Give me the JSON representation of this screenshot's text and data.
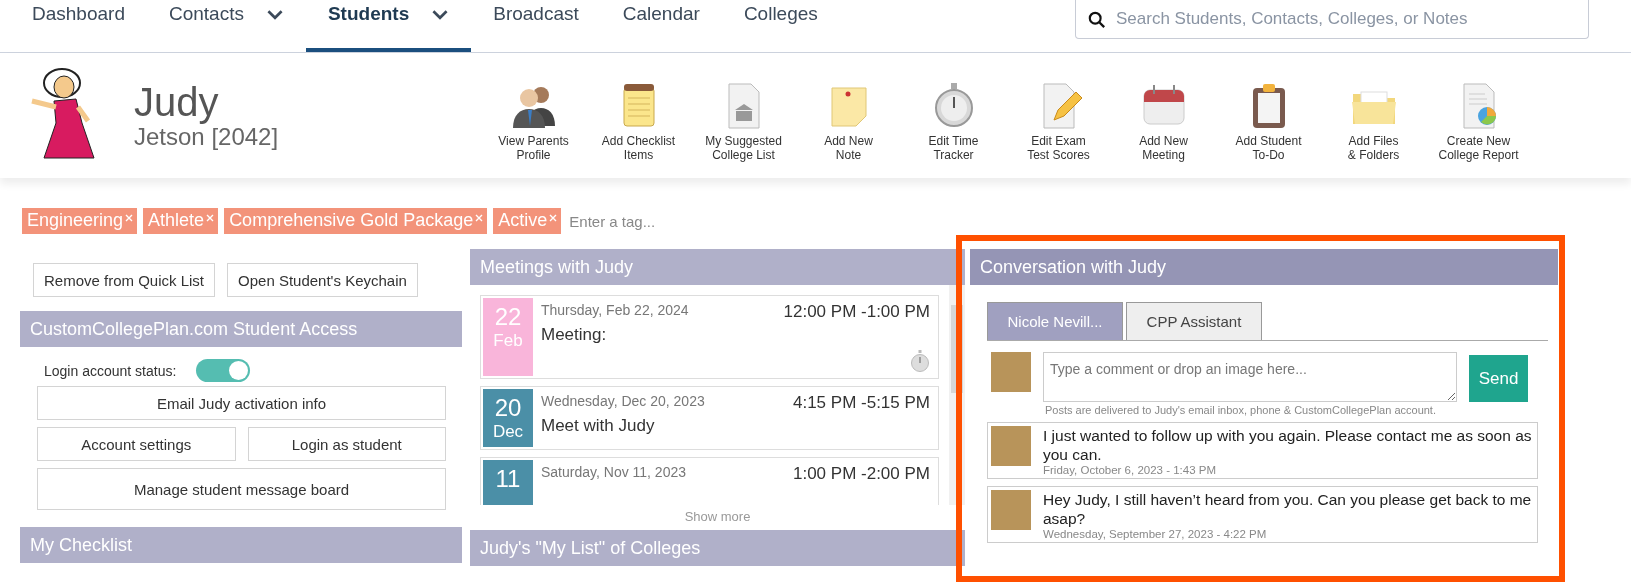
{
  "nav": {
    "items": [
      {
        "label": "Dashboard",
        "selected": false,
        "dropdown": false
      },
      {
        "label": "Contacts",
        "selected": false,
        "dropdown": true
      },
      {
        "label": "Students",
        "selected": true,
        "dropdown": true
      },
      {
        "label": "Broadcast",
        "selected": false,
        "dropdown": false
      },
      {
        "label": "Calendar",
        "selected": false,
        "dropdown": false
      },
      {
        "label": "Colleges",
        "selected": false,
        "dropdown": false
      }
    ],
    "search": {
      "placeholder": "Search Students, Contacts, Colleges, or Notes"
    }
  },
  "student": {
    "first_name": "Judy",
    "last_name": "Jetson [2042]"
  },
  "toolbar": [
    {
      "kind": "people",
      "lines": [
        "View Parents",
        "Profile"
      ]
    },
    {
      "kind": "notepad",
      "lines": [
        "Add Checklist",
        "Items"
      ]
    },
    {
      "kind": "college-doc",
      "lines": [
        "My Suggested",
        "College List"
      ]
    },
    {
      "kind": "note",
      "lines": [
        "Add New",
        "Note"
      ]
    },
    {
      "kind": "stopwatch",
      "lines": [
        "Edit Time",
        "Tracker"
      ]
    },
    {
      "kind": "doc-pencil",
      "lines": [
        "Edit Exam",
        "Test Scores"
      ]
    },
    {
      "kind": "calendar",
      "lines": [
        "Add New",
        "Meeting"
      ]
    },
    {
      "kind": "clipboard",
      "lines": [
        "Add Student",
        "To-Do"
      ]
    },
    {
      "kind": "folder",
      "lines": [
        "Add Files",
        "& Folders"
      ]
    },
    {
      "kind": "report",
      "lines": [
        "Create New",
        "College Report"
      ]
    }
  ],
  "tags": {
    "items": [
      "Engineering",
      "Athlete",
      "Comprehensive Gold Package",
      "Active"
    ],
    "placeholder": "Enter a tag..."
  },
  "left": {
    "buttons": [
      "Remove from Quick List",
      "Open Student's Keychain"
    ],
    "access": {
      "title": "CustomCollegePlan.com Student Access",
      "status_label": "Login account status:",
      "status_on": true,
      "actions": [
        [
          "Email Judy activation info"
        ],
        [
          "Account settings",
          "Login as student"
        ],
        [
          "Manage student message board"
        ]
      ]
    },
    "checklist": {
      "title": "My Checklist"
    }
  },
  "meetings": {
    "title": "Meetings with Judy",
    "items": [
      {
        "day": "22",
        "month": "Feb",
        "color": "#f9b5da",
        "date": "Thursday, Feb 22, 2024",
        "time": "12:00 PM -1:00 PM",
        "title": "Meeting:",
        "timer": true
      },
      {
        "day": "20",
        "month": "Dec",
        "color": "#4b8fa7",
        "date": "Wednesday, Dec 20, 2023",
        "time": "4:15 PM -5:15 PM",
        "title": "Meet with Judy",
        "timer": false
      },
      {
        "day": "11",
        "color": "#4b8fa7",
        "date": "Saturday, Nov 11, 2023",
        "time": "1:00 PM -2:00 PM",
        "timer": false
      }
    ],
    "show_more": "Show more"
  },
  "colleges": {
    "title": "Judy's \"My List\" of Colleges"
  },
  "conversation": {
    "title": "Conversation with Judy",
    "tabs": [
      {
        "label": "Nicole Nevill...",
        "selected": true
      },
      {
        "label": "CPP Assistant",
        "selected": false
      }
    ],
    "comment": {
      "placeholder": "Type a comment or drop an image here..."
    },
    "send": "Send",
    "note": "Posts are delivered to Judy's email inbox, phone & CustomCollegePlan account.",
    "messages": [
      {
        "text": "I just wanted to follow up with you again. Please contact me as soon as you can.",
        "time": "Friday, October 6, 2023 - 1:43 PM"
      },
      {
        "text": "Hey Judy, I still haven’t heard from you. Can you please get back to me asap?",
        "time": "Wednesday, September 27, 2023 - 4:22 PM"
      }
    ]
  }
}
